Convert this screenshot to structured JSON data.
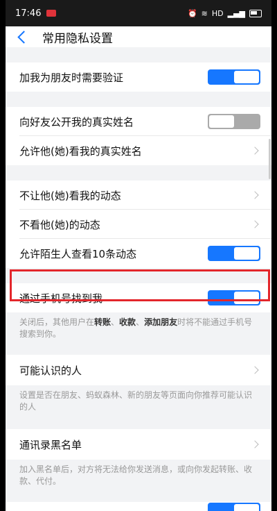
{
  "status_bar": {
    "time": "17:46",
    "network": "HD"
  },
  "nav": {
    "title": "常用隐私设置"
  },
  "settings": {
    "verify_friend": {
      "label": "加我为朋友时需要验证",
      "on": true
    },
    "show_real_name": {
      "label": "向好友公开我的真实姓名",
      "on": false
    },
    "allow_view_name": {
      "label": "允许他(她)看我的真实姓名"
    },
    "hide_my_feed": {
      "label": "不让他(她)看我的动态"
    },
    "hide_their_feed": {
      "label": "不看他(她)的动态"
    },
    "stranger_view": {
      "label": "允许陌生人查看10条动态",
      "on": true
    },
    "find_by_phone": {
      "label": "通过手机号找到我",
      "on": true
    },
    "find_by_phone_note": {
      "prefix": "关闭后，其他用户在",
      "k1": "转账",
      "sep1": "、",
      "k2": "收款",
      "sep2": "、",
      "k3": "添加朋友",
      "suffix": "时将不能通过手机号搜索到你。"
    },
    "people_you_may_know": {
      "label": "可能认识的人"
    },
    "people_note": "设置是否在朋友、蚂蚁森林、新的朋友等页面向你推荐可能认识的人",
    "contacts_blacklist": {
      "label": "通讯录黑名单"
    },
    "blacklist_note": "加入黑名单后，对方将无法给你发送消息，或向你发起转账、收款、代付。"
  },
  "colors": {
    "accent": "#1677ff",
    "highlight": "#e3262b"
  }
}
